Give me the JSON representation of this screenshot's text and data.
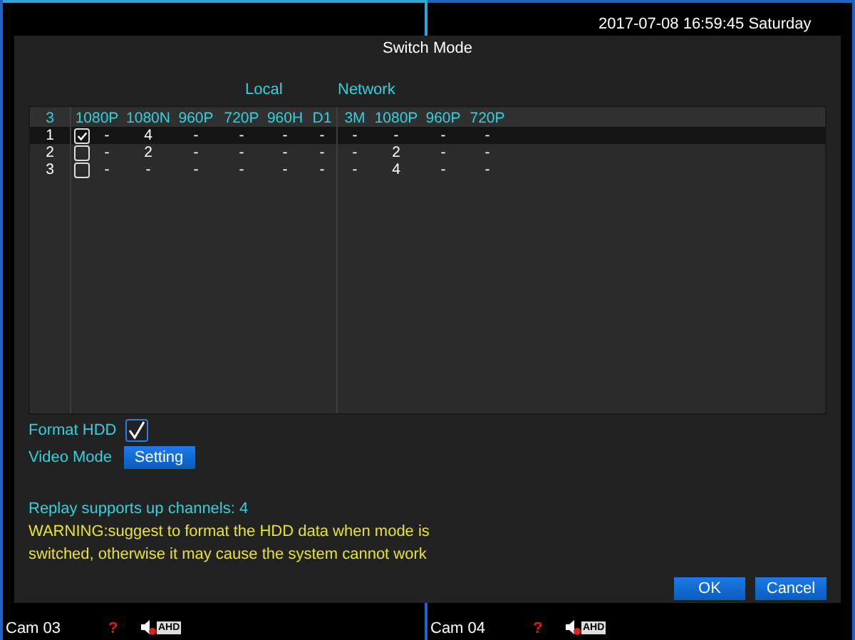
{
  "datetime": "2017-07-08 16:59:45  Saturday",
  "dialog": {
    "title": "Switch Mode",
    "groups": [
      {
        "label": "Local"
      },
      {
        "label": "Network"
      }
    ],
    "table": {
      "count": "3",
      "columns": [
        "1080P",
        "1080N",
        "960P",
        "720P",
        "960H",
        "D1",
        "3M",
        "1080P",
        "960P",
        "720P"
      ],
      "rows": [
        {
          "num": "1",
          "selected": true,
          "checked": true,
          "values": [
            "-",
            "4",
            "-",
            "-",
            "-",
            "-",
            "-",
            "-",
            "-",
            "-"
          ]
        },
        {
          "num": "2",
          "selected": false,
          "checked": false,
          "values": [
            "-",
            "2",
            "-",
            "-",
            "-",
            "-",
            "-",
            "2",
            "-",
            "-"
          ]
        },
        {
          "num": "3",
          "selected": false,
          "checked": false,
          "values": [
            "-",
            "-",
            "-",
            "-",
            "-",
            "-",
            "-",
            "4",
            "-",
            "-"
          ]
        }
      ]
    },
    "format_hdd": {
      "label": "Format HDD",
      "checked": true
    },
    "video_mode": {
      "label": "Video Mode",
      "button": "Setting"
    },
    "replay": "Replay supports up channels:  4",
    "warning": "WARNING:suggest to format the HDD data when mode is switched, otherwise it may cause the system cannot work",
    "buttons": [
      "OK",
      "Cancel"
    ]
  },
  "cameras": [
    {
      "name": "Cam 03",
      "alert": "?",
      "badge": "AHD"
    },
    {
      "name": "Cam 04",
      "alert": "?",
      "badge": "AHD"
    }
  ]
}
